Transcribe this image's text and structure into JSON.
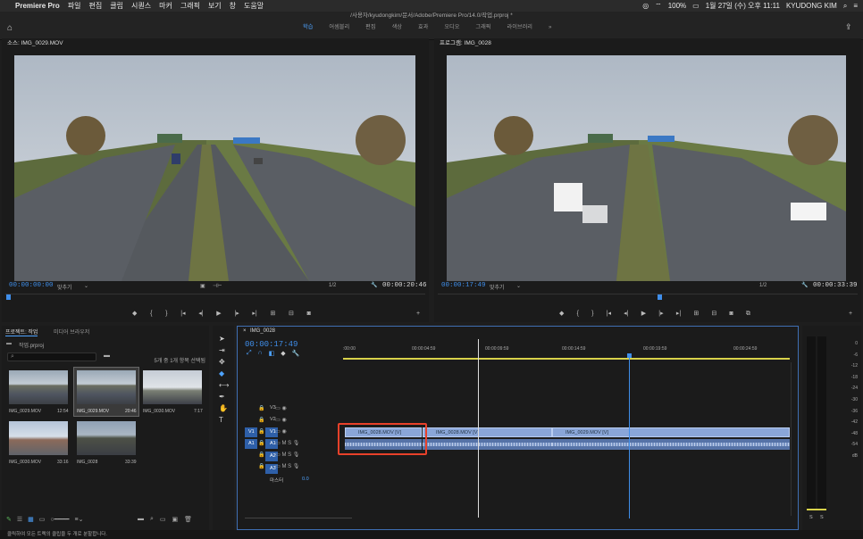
{
  "menubar": {
    "app": "Premiere Pro",
    "items": [
      "파일",
      "편집",
      "클립",
      "시퀀스",
      "마커",
      "그래픽",
      "보기",
      "창",
      "도움말"
    ],
    "battery": "100%",
    "datetime": "1월 27일 (수) 오후 11:11",
    "user": "KYUDONG KIM"
  },
  "header": {
    "project_path": "/사용자/kyudongkim/문서/Adobe/Premiere Pro/14.0/작업.prproj *",
    "workspaces": [
      "학습",
      "어셈블리",
      "편집",
      "색상",
      "효과",
      "오디오",
      "그래픽",
      "라이브러리"
    ],
    "active_workspace": "학습",
    "more": "»"
  },
  "source_monitor": {
    "title": "소스: IMG_0029.MOV",
    "timecode": "00:00:00:00",
    "fit": "맞추기",
    "resolution": "1/2",
    "duration": "00:00:20:46"
  },
  "program_monitor": {
    "title": "프로그램: IMG_0028",
    "timecode": "00:00:17:49",
    "fit": "맞추기",
    "resolution": "1/2",
    "duration": "00:00:33:39"
  },
  "project_panel": {
    "tab_project": "프로젝트: 작업",
    "tab_media": "미디어 브라우저",
    "filename": "작업.prproj",
    "selection_info": "5개 중 1개 항목 선택됨",
    "items": [
      {
        "name": "IMG_0029.MOV",
        "duration": "12:54"
      },
      {
        "name": "IMG_0029.MOV",
        "duration": "20:46"
      },
      {
        "name": "IMG_0030.MOV",
        "duration": "7:17"
      },
      {
        "name": "IMG_0030.MOV",
        "duration": "33:16"
      },
      {
        "name": "IMG_0028",
        "duration": "33:39"
      }
    ]
  },
  "timeline": {
    "sequence_tab": "IMG_0028",
    "timecode": "00:00:17:49",
    "ruler": [
      ":00:00",
      "00:00:04:59",
      "00:00:09:59",
      "00:00:14:59",
      "00:00:19:59",
      "00:00:24:59"
    ],
    "video_tracks": [
      "V3",
      "V2",
      "V1"
    ],
    "audio_tracks": [
      "A1",
      "A2",
      "A3"
    ],
    "source_patch_v": "V1",
    "source_patch_a": "A1",
    "master_label": "마스터",
    "master_value": "0.0",
    "clips": [
      {
        "label": "IMG_0028.MOV [V]"
      },
      {
        "label": "IMG_0028.MOV [V]"
      },
      {
        "label": "IMG_0029.MOV [V]"
      }
    ],
    "selection_highlight_color": "#e8412a",
    "playhead_color": "#3f8eea"
  },
  "meter": {
    "scale": [
      "0",
      "-6",
      "-12",
      "-18",
      "-24",
      "-30",
      "-36",
      "-42",
      "-48",
      "-54",
      "dB"
    ],
    "solo": [
      "S",
      "S"
    ]
  },
  "status": "클릭하여 모든 트랙의 클립을 두 개로 분할합니다."
}
